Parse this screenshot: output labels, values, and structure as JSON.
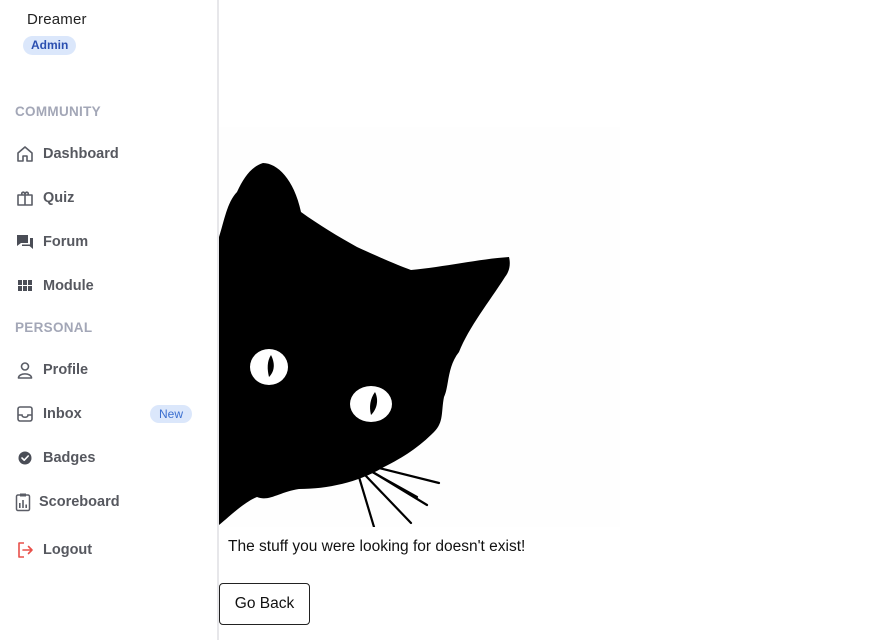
{
  "user": {
    "name": "Dreamer",
    "role": "Admin"
  },
  "sidebar": {
    "sections": [
      {
        "title": "COMMUNITY",
        "items": [
          {
            "label": "Dashboard",
            "icon": "home-icon"
          },
          {
            "label": "Quiz",
            "icon": "quiz-icon"
          },
          {
            "label": "Forum",
            "icon": "forum-icon"
          },
          {
            "label": "Module",
            "icon": "grid-icon"
          }
        ]
      },
      {
        "title": "PERSONAL",
        "items": [
          {
            "label": "Profile",
            "icon": "user-icon"
          },
          {
            "label": "Inbox",
            "icon": "inbox-icon",
            "badge": "New"
          },
          {
            "label": "Badges",
            "icon": "badge-check-icon"
          },
          {
            "label": "Scoreboard",
            "icon": "clipboard-icon"
          },
          {
            "label": "Logout",
            "icon": "logout-icon"
          }
        ]
      }
    ]
  },
  "main": {
    "illustration": "peeking-black-cat",
    "message": "The stuff you were looking for doesn't exist!",
    "back_button": "Go Back"
  },
  "colors": {
    "badge_bg": "#dbe7fb",
    "badge_text": "#2b4fb0",
    "section_title": "#a3a7b7",
    "nav_text": "#56585f",
    "logout_icon": "#e8504a",
    "border": "#e7e7ea"
  }
}
